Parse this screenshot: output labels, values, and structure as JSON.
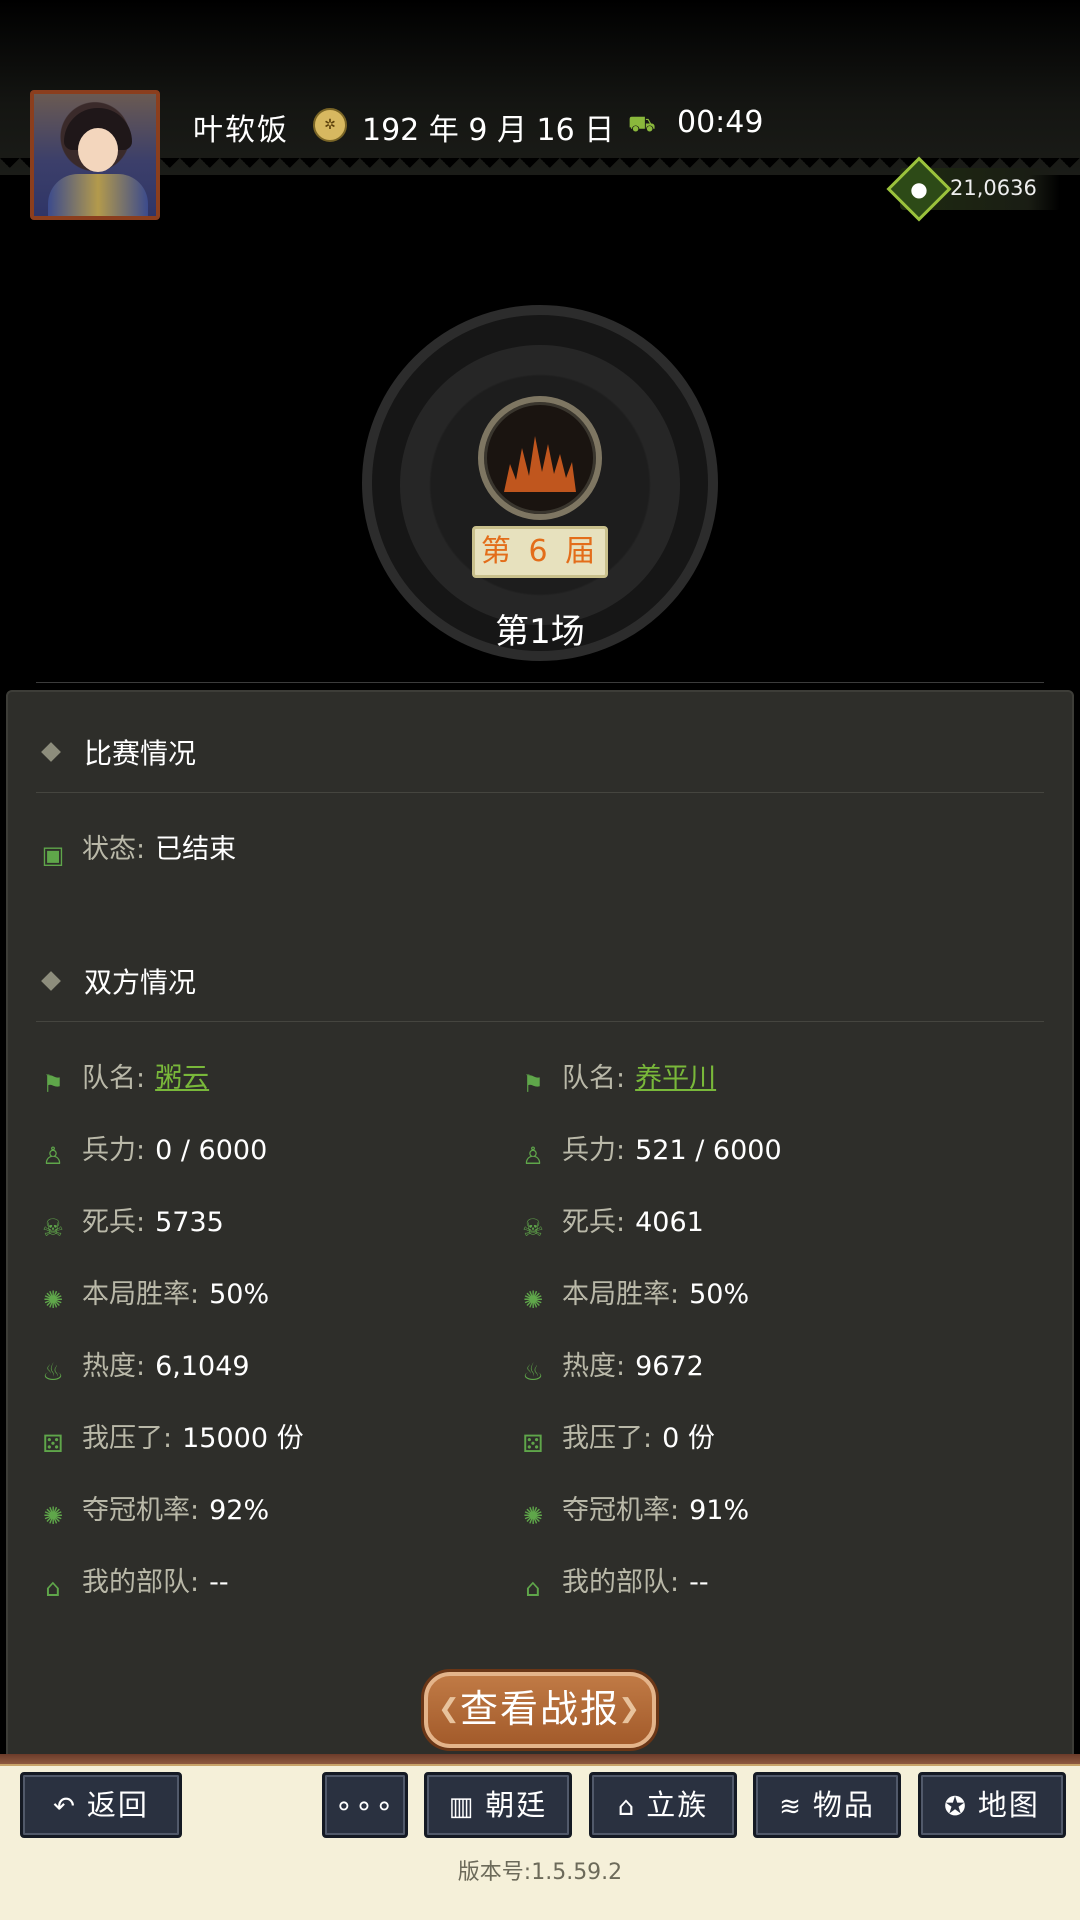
{
  "header": {
    "player_name": "叶软饭",
    "date": "192 年 9 月 16 日",
    "time": "00:49",
    "gold": "21,0636"
  },
  "match": {
    "round_badge": "第 6 届",
    "title": "第1场"
  },
  "section_match": {
    "heading": "比赛情况",
    "status_label": "状态:",
    "status_value": "已结束"
  },
  "section_teams": {
    "heading": "双方情况",
    "left": {
      "team_label": "队名:",
      "team_name": "粥云",
      "troops_label": "兵力:",
      "troops_value": "0 / 6000",
      "dead_label": "死兵:",
      "dead_value": "5735",
      "winrate_label": "本局胜率:",
      "winrate_value": "50%",
      "heat_label": "热度:",
      "heat_value": "6,1049",
      "bet_label": "我压了:",
      "bet_value": "15000 份",
      "champ_label": "夺冠机率:",
      "champ_value": "92%",
      "my_troop_label": "我的部队:",
      "my_troop_value": "--"
    },
    "right": {
      "team_label": "队名:",
      "team_name": "养平川",
      "troops_label": "兵力:",
      "troops_value": "521 / 6000",
      "dead_label": "死兵:",
      "dead_value": "4061",
      "winrate_label": "本局胜率:",
      "winrate_value": "50%",
      "heat_label": "热度:",
      "heat_value": "9672",
      "bet_label": "我压了:",
      "bet_value": "0 份",
      "champ_label": "夺冠机率:",
      "champ_value": "91%",
      "my_troop_label": "我的部队:",
      "my_troop_value": "--"
    }
  },
  "actions": {
    "view_report": "查看战报"
  },
  "nav": {
    "back": "返回",
    "more": "∘∘∘",
    "court": "朝廷",
    "clan": "立族",
    "items": "物品",
    "map": "地图"
  },
  "footer": {
    "version": "版本号:1.5.59.2"
  },
  "colors": {
    "accent_green": "#79b83a",
    "badge_orange": "#e36d1a",
    "panel_bg": "#2e2e2a"
  }
}
